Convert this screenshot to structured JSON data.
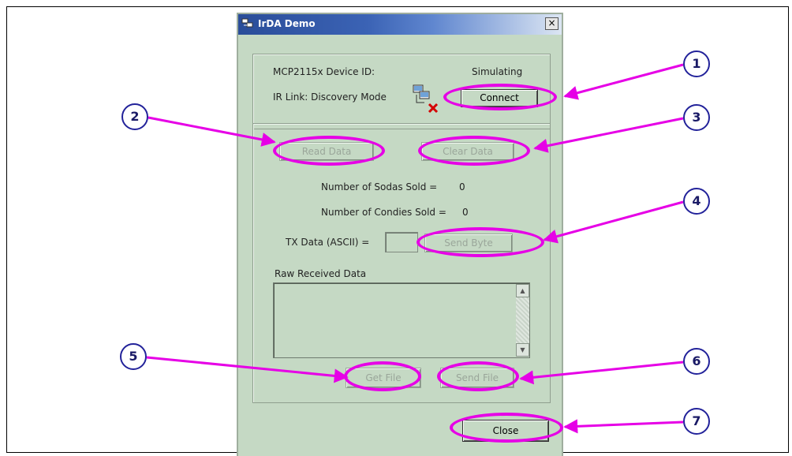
{
  "window": {
    "title": "IrDA Demo",
    "close_glyph": "×"
  },
  "status": {
    "device_id_label": "MCP2115x Device ID:",
    "device_id_value": "Simulating",
    "ir_link_label": "IR Link: Discovery Mode",
    "connect_button": "Connect"
  },
  "data_panel": {
    "read_data_button": "Read Data",
    "clear_data_button": "Clear Data",
    "sodas_label": "Number of Sodas Sold =",
    "sodas_value": "0",
    "candies_label": "Number of Condies Sold =",
    "candies_value": "0",
    "tx_label": "TX Data (ASCII) =",
    "tx_value": "",
    "send_byte_button": "Send Byte",
    "raw_label": "Raw Received Data",
    "get_file_button": "Get File",
    "send_file_button": "Send File"
  },
  "footer": {
    "close_button": "Close"
  },
  "callouts": [
    "1",
    "2",
    "3",
    "4",
    "5",
    "6",
    "7"
  ],
  "colors": {
    "window_bg": "#c5d9c4",
    "highlight": "#e600e6",
    "callout_text": "#1a1a66"
  },
  "icons": {
    "app_icon": "network-computers-icon",
    "link_status_icon": "network-disconnected-icon"
  }
}
